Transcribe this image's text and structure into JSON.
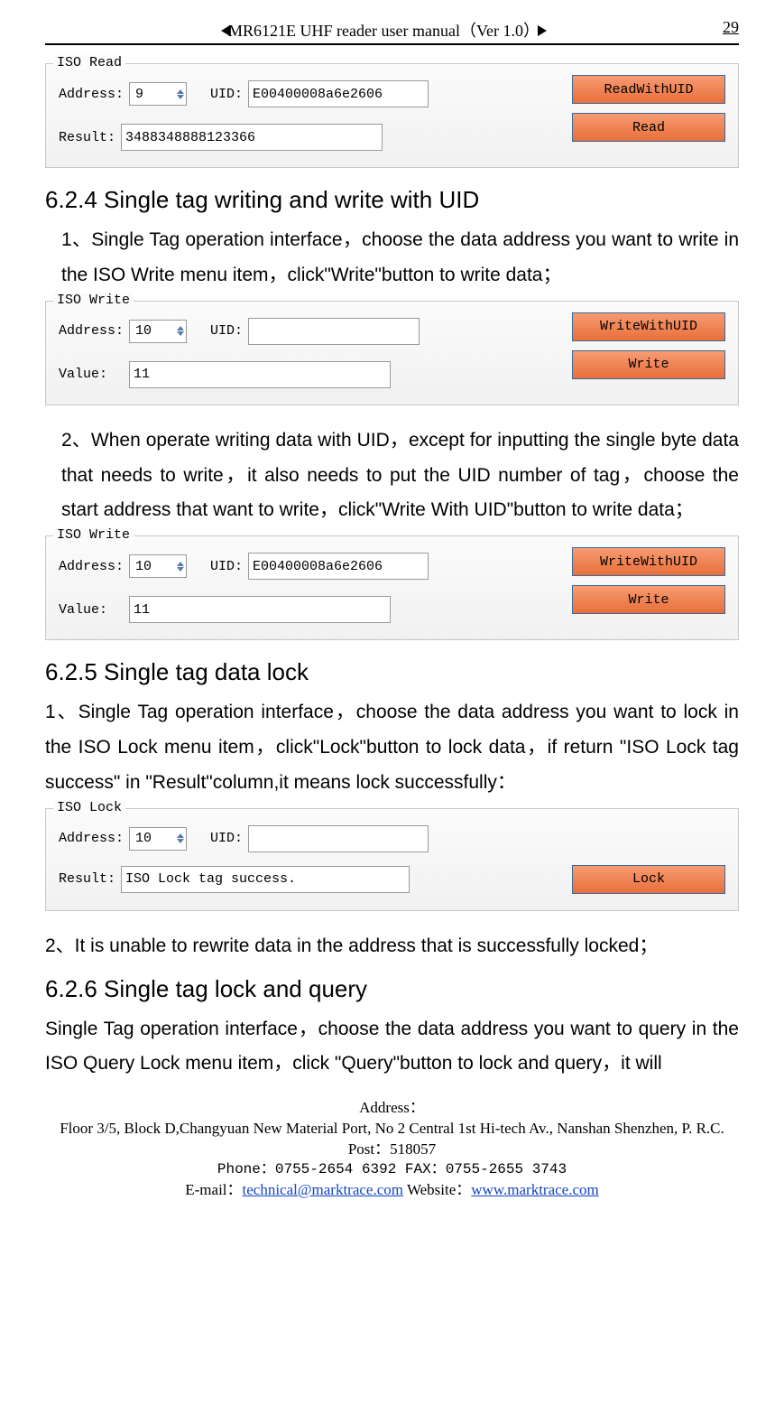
{
  "header": {
    "title": "MR6121E UHF reader user manual（Ver 1.0）",
    "page": "29"
  },
  "iso_read": {
    "title": "ISO Read",
    "labels": {
      "address": "Address:",
      "uid": "UID:",
      "result": "Result:"
    },
    "address": "9",
    "uid": "E00400008a6e2606",
    "result": "3488348888123366",
    "buttons": {
      "read_uid": "ReadWithUID",
      "read": "Read"
    }
  },
  "section_624": {
    "heading": "6.2.4 Single tag writing and write with UID",
    "p1": "1、Single Tag operation interface，choose the data address you want to write in the ISO Write menu item，click\"Write\"button to write data；",
    "p2": "2、When operate writing data with UID，except for inputting the single byte data that needs to write，it also needs to put the UID number of tag，choose the start address that want to write，click\"Write With UID\"button to write data；"
  },
  "iso_write_a": {
    "title": "ISO Write",
    "labels": {
      "address": "Address:",
      "uid": "UID:",
      "value": "Value:"
    },
    "address": "10",
    "uid": "",
    "value": "11",
    "buttons": {
      "write_uid": "WriteWithUID",
      "write": "Write"
    }
  },
  "iso_write_b": {
    "title": "ISO Write",
    "labels": {
      "address": "Address:",
      "uid": "UID:",
      "value": "Value:"
    },
    "address": "10",
    "uid": "E00400008a6e2606",
    "value": "11",
    "buttons": {
      "write_uid": "WriteWithUID",
      "write": "Write"
    }
  },
  "section_625": {
    "heading": "6.2.5 Single tag data lock",
    "p1": "1、Single Tag operation interface，choose the data address you want to lock in the ISO Lock menu item，click\"Lock\"button to lock data，if return \"ISO Lock tag success\" in \"Result\"column,it means lock successfully：",
    "p2": "2、It is unable to rewrite data in the address that is successfully locked；"
  },
  "iso_lock": {
    "title": "ISO Lock",
    "labels": {
      "address": "Address:",
      "uid": "UID:",
      "result": "Result:"
    },
    "address": "10",
    "uid": "",
    "result": "ISO Lock tag success.",
    "buttons": {
      "lock": "Lock"
    }
  },
  "section_626": {
    "heading": "6.2.6 Single tag lock and query",
    "p1": "Single Tag operation interface，choose the data address you want to query in the ISO Query Lock menu item，click \"Query\"button to lock and query，it will"
  },
  "footer": {
    "addr_lbl": "Address：",
    "addr": "Floor 3/5, Block D,Changyuan New  Material Port, No 2 Central 1st Hi-tech Av., Nanshan Shenzhen, P. R.C.   Post：518057",
    "phone": "Phone：0755-2654 6392    FAX：0755-2655 3743",
    "email_lbl": "E-mail：",
    "email": "technical@marktrace.com",
    "web_lbl": "      Website：",
    "web": "www.marktrace.com"
  }
}
